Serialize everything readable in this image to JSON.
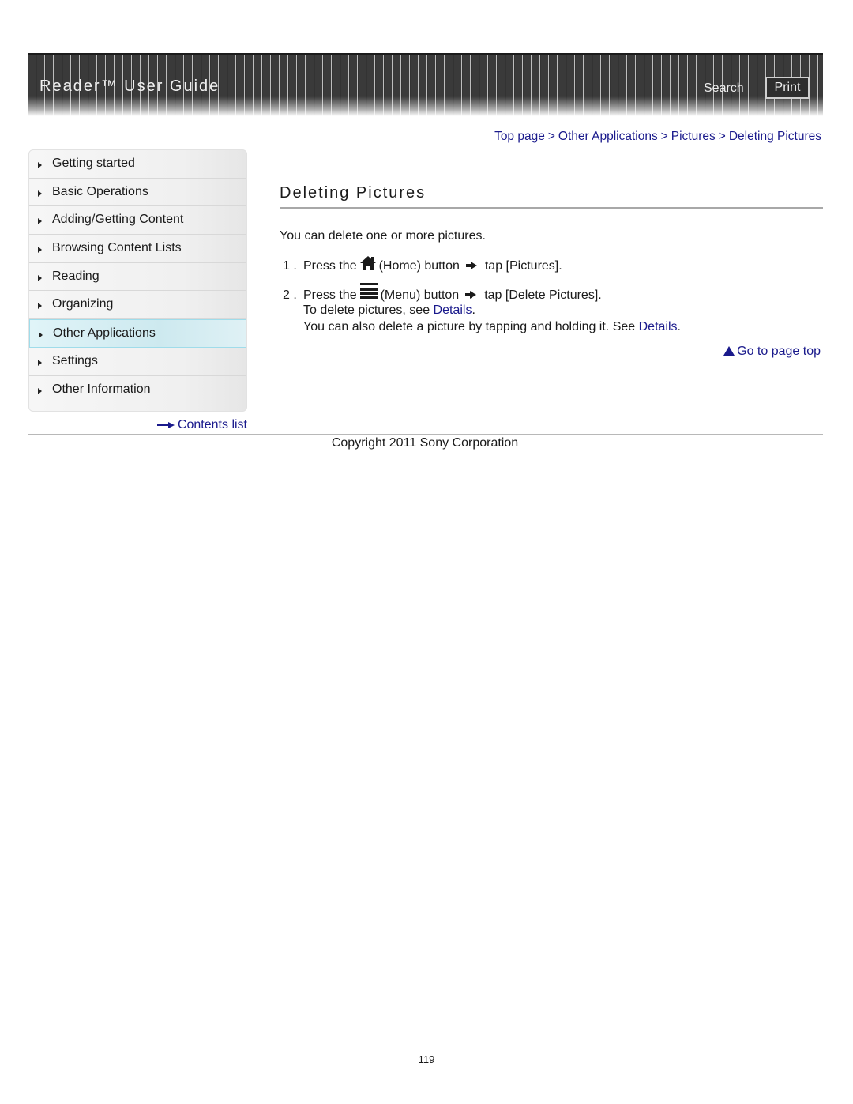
{
  "header": {
    "title": "Reader™ User Guide",
    "search_label": "Search",
    "print_label": "Print"
  },
  "breadcrumb": {
    "items": [
      "Top page",
      "Other Applications",
      "Pictures",
      "Deleting Pictures"
    ],
    "separator": ">"
  },
  "sidebar": {
    "items": [
      {
        "label": "Getting started",
        "active": false
      },
      {
        "label": "Basic Operations",
        "active": false
      },
      {
        "label": "Adding/Getting Content",
        "active": false
      },
      {
        "label": "Browsing Content Lists",
        "active": false
      },
      {
        "label": "Reading",
        "active": false
      },
      {
        "label": "Organizing",
        "active": false
      },
      {
        "label": "Other Applications",
        "active": true
      },
      {
        "label": "Settings",
        "active": false
      },
      {
        "label": "Other Information",
        "active": false
      }
    ],
    "contents_list_label": "Contents list"
  },
  "main": {
    "title": "Deleting Pictures",
    "intro": "You can delete one or more pictures.",
    "steps": [
      {
        "number": "1 .",
        "prefix": "Press the",
        "icon": "home-icon",
        "button": "(Home) button",
        "action": "tap [Pictures]."
      },
      {
        "number": "2 .",
        "prefix": "Press the",
        "icon": "menu-icon",
        "button": "(Menu) button",
        "action": "tap [Delete Pictures]."
      }
    ],
    "notes": [
      {
        "text": "To delete pictures, see ",
        "link": "Details",
        "suffix": "."
      },
      {
        "text": "You can also delete a picture by tapping and holding it. See ",
        "link": "Details",
        "suffix": "."
      }
    ],
    "go_to_top_label": "Go to page top"
  },
  "footer": {
    "copyright": "Copyright 2011 Sony Corporation",
    "page_number": "119"
  },
  "colors": {
    "link": "#1a1a8c",
    "header_bg": "#2e2e2e",
    "active_nav_bg": "#cde9ef",
    "active_nav_border": "#9fdcea"
  }
}
